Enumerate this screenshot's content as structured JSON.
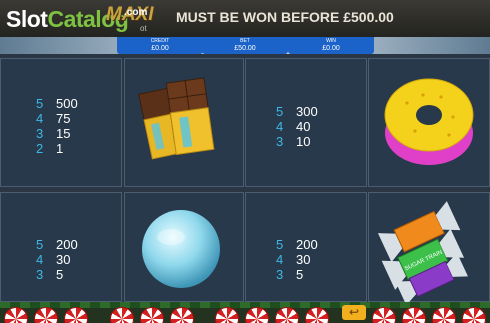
{
  "header": {
    "logo_slot": "Slot",
    "logo_catalog": "Catalog",
    "logo_dotcom": ".com",
    "game_logo": "MAXI",
    "game_logo_sub": "ot",
    "jackpot_text": "MUST BE WON BEFORE  £500.00"
  },
  "meters": {
    "credit_label": "CREDIT",
    "credit_value": "£0.00",
    "bet_label": "BET",
    "bet_value": "£50.00",
    "win_label": "WIN",
    "win_value": "£0.00"
  },
  "paytable": {
    "chocolate": [
      {
        "count": "5",
        "pay": "500"
      },
      {
        "count": "4",
        "pay": "75"
      },
      {
        "count": "3",
        "pay": "15"
      },
      {
        "count": "2",
        "pay": "1"
      }
    ],
    "donut": [
      {
        "count": "5",
        "pay": "300"
      },
      {
        "count": "4",
        "pay": "40"
      },
      {
        "count": "3",
        "pay": "10"
      }
    ],
    "gumball": [
      {
        "count": "5",
        "pay": "200"
      },
      {
        "count": "4",
        "pay": "30"
      },
      {
        "count": "3",
        "pay": "5"
      }
    ],
    "candy": [
      {
        "count": "5",
        "pay": "200"
      },
      {
        "count": "4",
        "pay": "30"
      },
      {
        "count": "3",
        "pay": "5"
      }
    ]
  },
  "candy_wrapper_text": "SUGAR TRAIN",
  "footer": {
    "back_icon": "return-arrow-icon"
  },
  "colors": {
    "panel": "#27394a",
    "count_color": "#3fb8e8",
    "meter_blue": "#1c63c9"
  }
}
